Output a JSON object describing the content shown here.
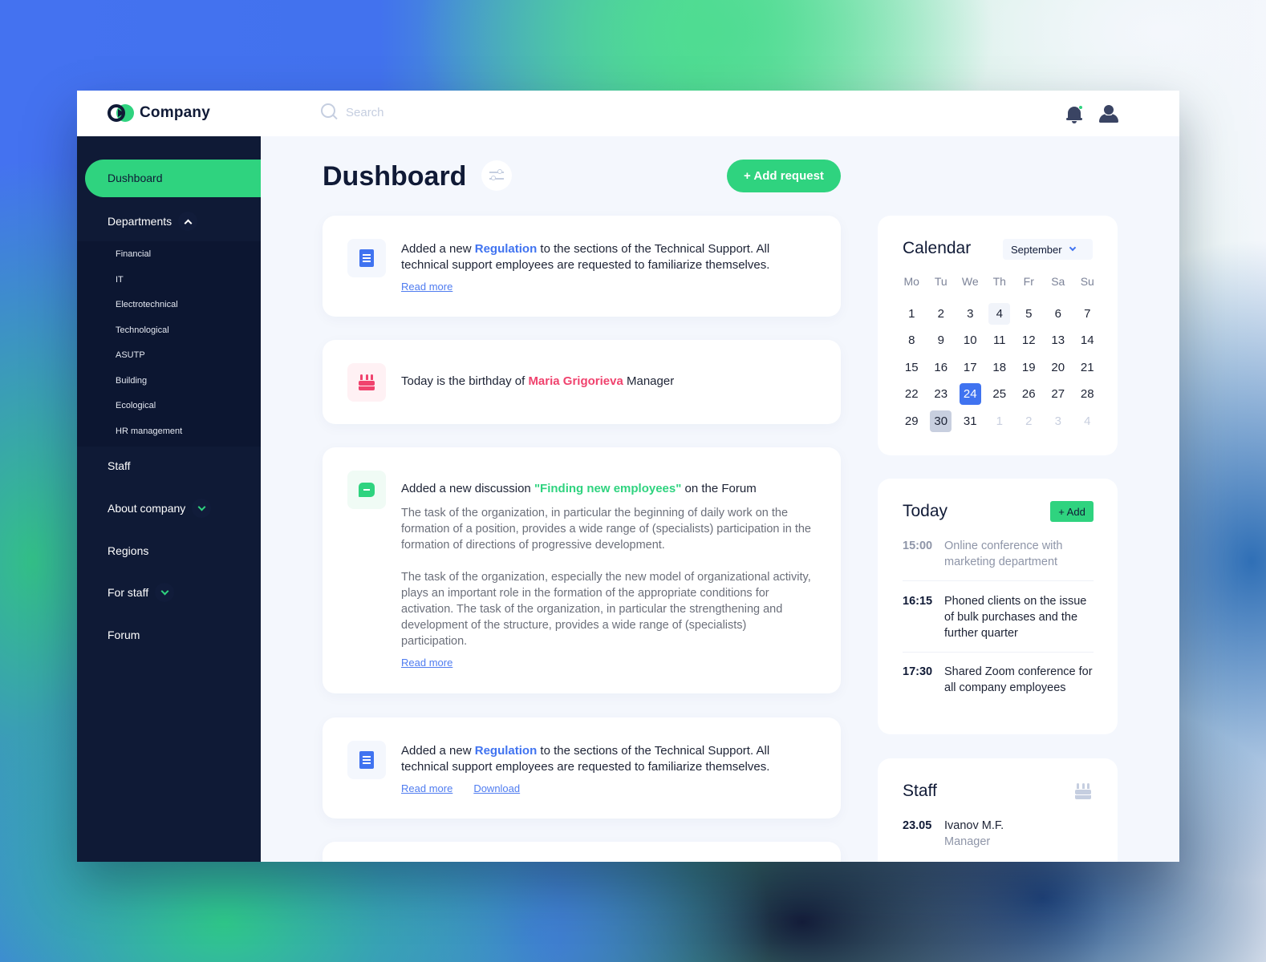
{
  "app": {
    "brand": "Company",
    "search_placeholder": "Search",
    "colors": {
      "accent_green": "#2fd37f",
      "accent_blue": "#4073f0",
      "accent_red": "#f0436e",
      "sidebar_bg": "#0f1a36"
    },
    "header_icons": [
      "bell-icon",
      "user-icon"
    ],
    "notifications_unread": true
  },
  "sidebar": {
    "active": "Dushboard",
    "items": [
      {
        "label": "Dushboard",
        "active": true
      },
      {
        "label": "Departments",
        "expanded": true,
        "children": [
          "Financial",
          "IT",
          "Electrotechnical",
          "Technological",
          "ASUTP",
          "Building",
          "Ecological",
          "HR management"
        ]
      },
      {
        "label": "Staff"
      },
      {
        "label": "About company",
        "expandable": true
      },
      {
        "label": "Regions"
      },
      {
        "label": "For staff",
        "expandable": true
      },
      {
        "label": "Forum"
      }
    ]
  },
  "main": {
    "title": "Dushboard",
    "add_request_label": "+ Add request",
    "feed": [
      {
        "icon": "document-icon",
        "pre": "Added a new ",
        "highlight": "Regulation",
        "post": " to the sections of the Technical Support. All technical support employees are requested to familiarize themselves.",
        "links": [
          "Read more"
        ]
      },
      {
        "icon": "birthday-cake-icon",
        "pre": "Today is the birthday of ",
        "highlight": "Maria Grigorieva",
        "post": " Manager"
      },
      {
        "icon": "chat-icon",
        "pre": "Added a new discussion ",
        "highlight": "\"Finding new employees\"",
        "post": " on the Forum",
        "paragraphs": [
          "The task of the organization, in particular the beginning of daily work on the formation of a position, provides a wide range of (specialists) participation in the formation of directions of progressive development.",
          "The task of the organization, especially the new model of organizational activity, plays an important role in the formation of the appropriate conditions for activation. The task of the organization, in particular the strengthening and development of the structure, provides a wide range of (specialists) participation."
        ],
        "links": [
          "Read more"
        ]
      },
      {
        "icon": "document-icon",
        "pre": "Added a new ",
        "highlight": "Regulation",
        "post": " to the sections of the Technical Support. All technical support employees are requested to familiarize themselves.",
        "links": [
          "Read more",
          "Download"
        ]
      }
    ]
  },
  "calendar": {
    "title": "Calendar",
    "month": "September",
    "weekdays": [
      "Mo",
      "Tu",
      "We",
      "Th",
      "Fr",
      "Sa",
      "Su"
    ],
    "days": [
      {
        "d": "1"
      },
      {
        "d": "2"
      },
      {
        "d": "3"
      },
      {
        "d": "4",
        "state": "today"
      },
      {
        "d": "5"
      },
      {
        "d": "6"
      },
      {
        "d": "7"
      },
      {
        "d": "8"
      },
      {
        "d": "9"
      },
      {
        "d": "10"
      },
      {
        "d": "11"
      },
      {
        "d": "12"
      },
      {
        "d": "13"
      },
      {
        "d": "14"
      },
      {
        "d": "15"
      },
      {
        "d": "16"
      },
      {
        "d": "17"
      },
      {
        "d": "18"
      },
      {
        "d": "19"
      },
      {
        "d": "20"
      },
      {
        "d": "21"
      },
      {
        "d": "22"
      },
      {
        "d": "23"
      },
      {
        "d": "24",
        "state": "selected"
      },
      {
        "d": "25"
      },
      {
        "d": "26"
      },
      {
        "d": "27"
      },
      {
        "d": "28"
      },
      {
        "d": "29"
      },
      {
        "d": "30",
        "state": "marked"
      },
      {
        "d": "31"
      },
      {
        "d": "1",
        "state": "muted"
      },
      {
        "d": "2",
        "state": "muted"
      },
      {
        "d": "3",
        "state": "muted"
      },
      {
        "d": "4",
        "state": "muted"
      }
    ]
  },
  "today": {
    "title": "Today",
    "add_label": "+ Add",
    "events": [
      {
        "time": "15:00",
        "desc": "Online conference with marketing department",
        "past": true
      },
      {
        "time": "16:15",
        "desc": "Phoned clients on the issue of bulk purchases and the further quarter",
        "past": false
      },
      {
        "time": "17:30",
        "desc": "Shared Zoom conference for all company employees",
        "past": false
      }
    ]
  },
  "staff": {
    "title": "Staff",
    "entries": [
      {
        "date": "23.05",
        "name": "Ivanov M.F.",
        "role": "Manager"
      }
    ]
  }
}
